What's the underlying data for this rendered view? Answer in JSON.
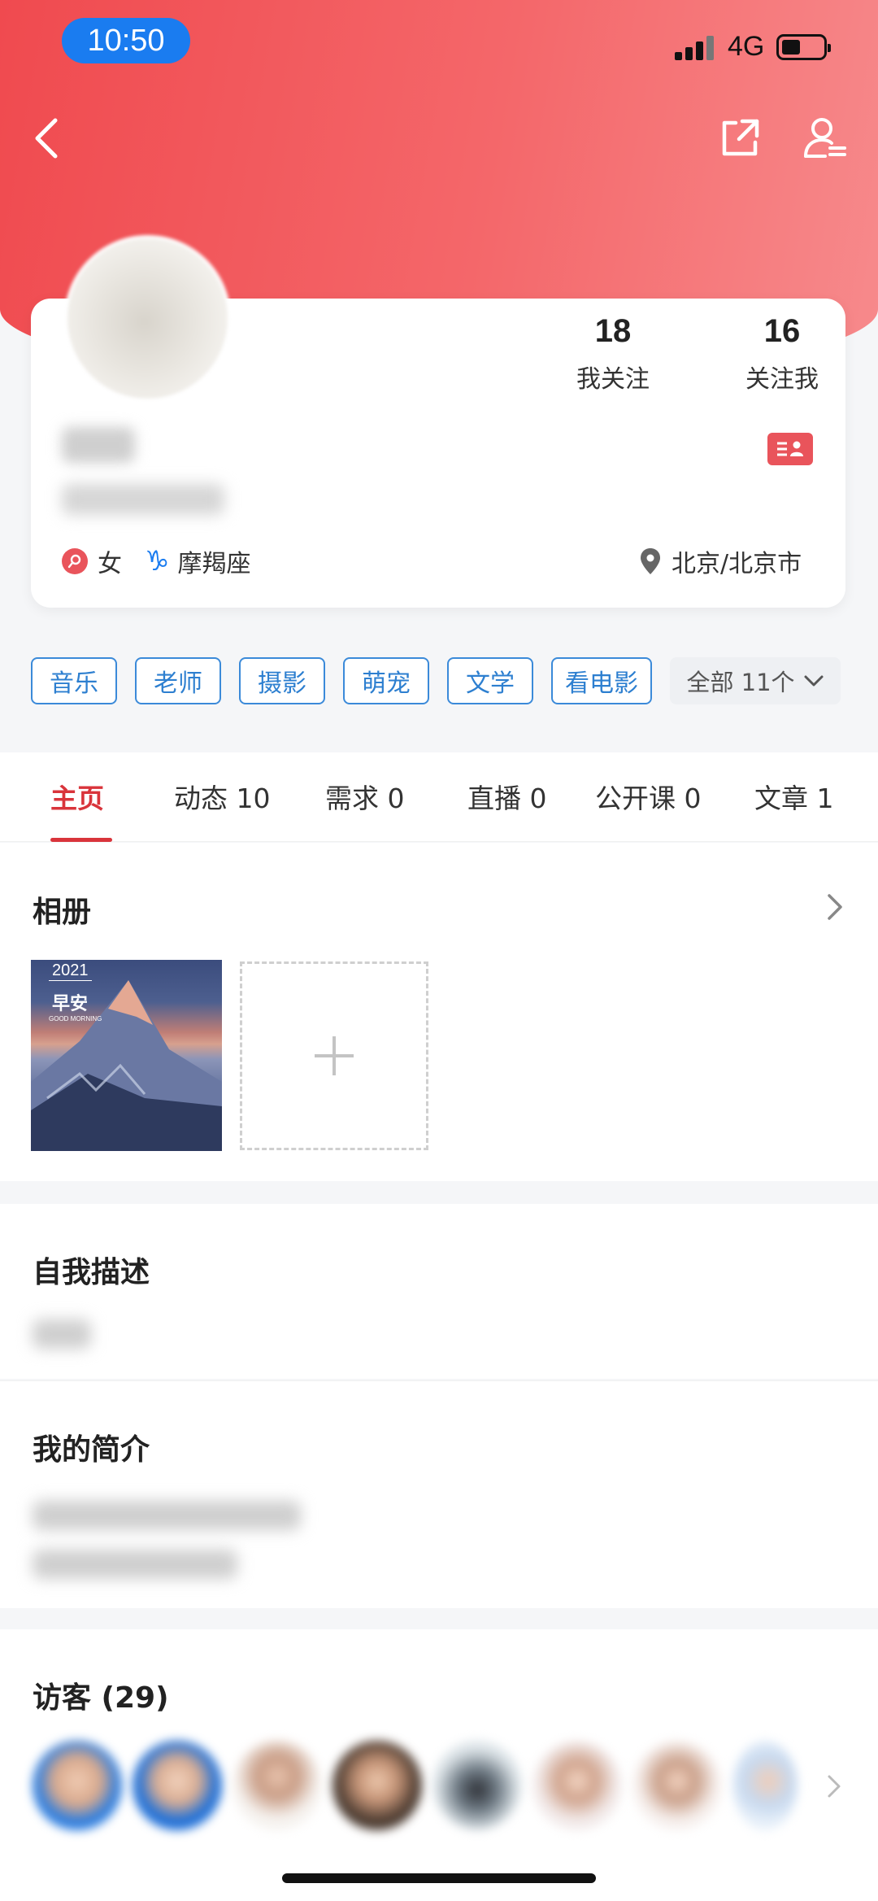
{
  "status_bar": {
    "time": "10:50",
    "network": "4G"
  },
  "profile": {
    "following_count": "18",
    "following_label": "我关注",
    "followers_count": "16",
    "followers_label": "关注我",
    "gender": "女",
    "zodiac": "摩羯座",
    "location": "北京/北京市"
  },
  "tags": [
    "音乐",
    "老师",
    "摄影",
    "萌宠",
    "文学",
    "看电影"
  ],
  "tags_all_label": "全部 11个",
  "tabs": [
    {
      "label": "主页"
    },
    {
      "label": "动态 10"
    },
    {
      "label": "需求 0"
    },
    {
      "label": "直播 0"
    },
    {
      "label": "公开课 0"
    },
    {
      "label": "文章 1"
    }
  ],
  "album": {
    "title": "相册",
    "photo": {
      "year": "2021",
      "caption": "早安",
      "subcaption": "GOOD MORNING"
    }
  },
  "self_description": {
    "title": "自我描述"
  },
  "intro": {
    "title": "我的简介"
  },
  "visitors": {
    "title": "访客 (29)"
  },
  "colors": {
    "brand_red": "#d9343b",
    "tag_blue": "#2d7fd0",
    "time_pill": "#1a7cf0"
  }
}
